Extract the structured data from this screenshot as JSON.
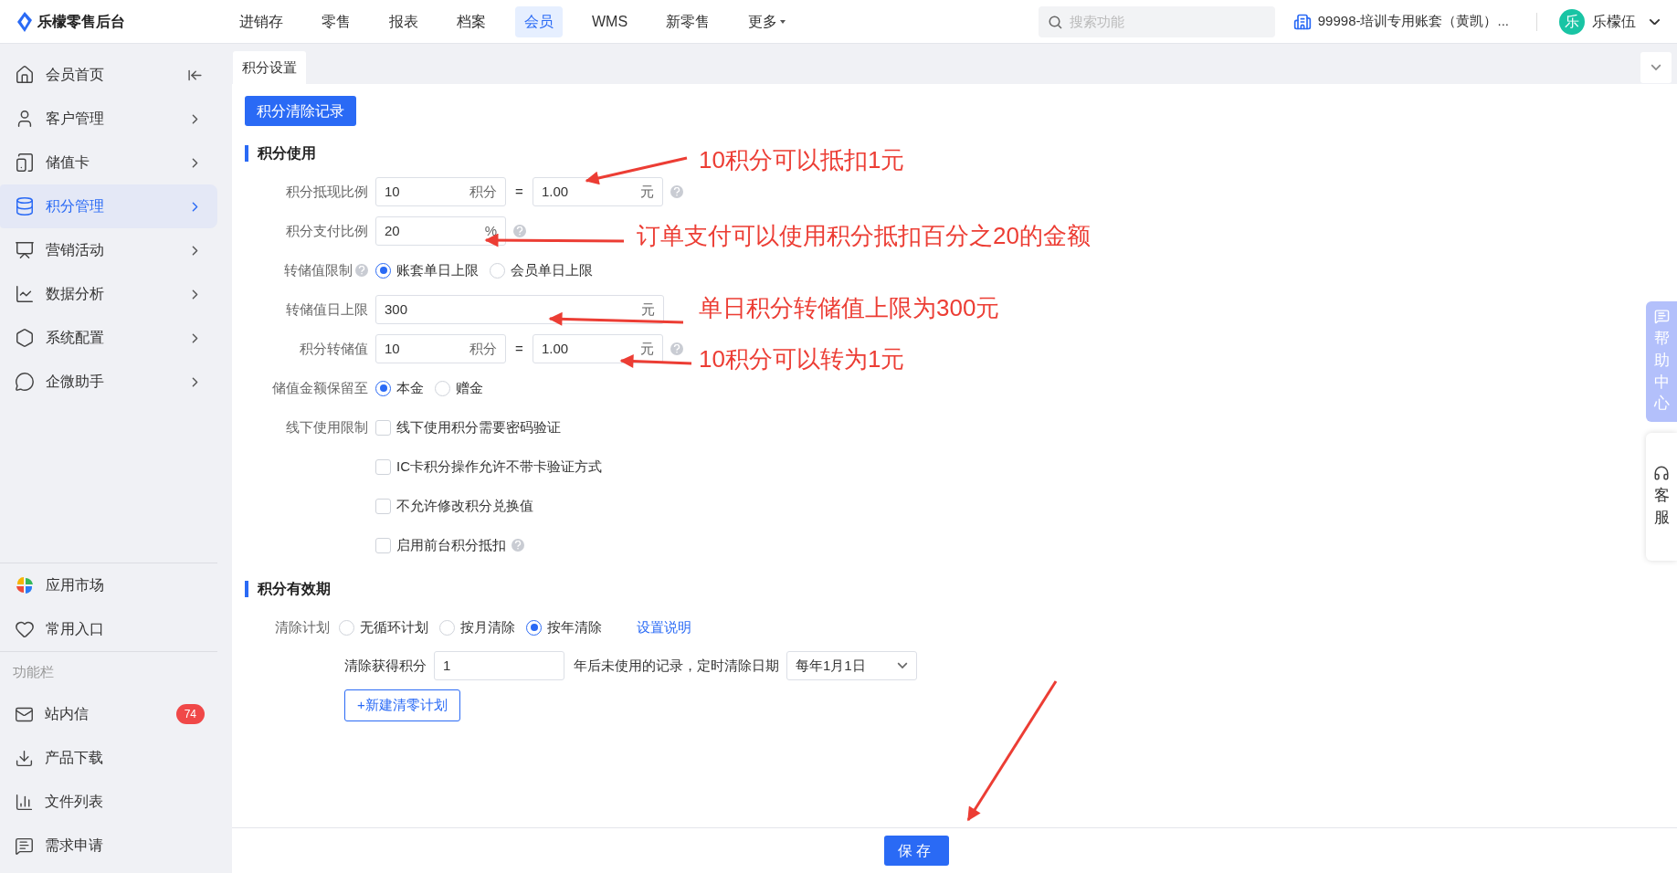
{
  "header": {
    "logo": "乐檬零售后台",
    "nav": [
      {
        "label": "进销存",
        "selected": false,
        "kind": "link"
      },
      {
        "label": "零售",
        "selected": false,
        "kind": "link"
      },
      {
        "label": "报表",
        "selected": false,
        "kind": "link"
      },
      {
        "label": "档案",
        "selected": false,
        "kind": "link"
      },
      {
        "label": "会员",
        "selected": true,
        "kind": "link"
      },
      {
        "label": "WMS",
        "selected": false,
        "kind": "link"
      },
      {
        "label": "新零售",
        "selected": false,
        "kind": "link"
      },
      {
        "label": "更多",
        "selected": false,
        "kind": "dropdown"
      }
    ],
    "search": {
      "placeholder": "搜索功能"
    },
    "account": "99998-培训专用账套（黄凯）...",
    "user": {
      "avatar": "乐",
      "name": "乐檬伍"
    }
  },
  "sidebar": {
    "items": [
      {
        "label": "会员首页",
        "selected": false,
        "kind": "collapse"
      },
      {
        "label": "客户管理",
        "selected": false,
        "kind": "submenu"
      },
      {
        "label": "储值卡",
        "selected": false,
        "kind": "submenu"
      },
      {
        "label": "积分管理",
        "selected": true,
        "kind": "submenu"
      },
      {
        "label": "营销活动",
        "selected": false,
        "kind": "submenu"
      },
      {
        "label": "数据分析",
        "selected": false,
        "kind": "submenu"
      },
      {
        "label": "系统配置",
        "selected": false,
        "kind": "submenu"
      },
      {
        "label": "企微助手",
        "selected": false,
        "kind": "submenu"
      }
    ],
    "apps": [
      {
        "label": "应用市场"
      },
      {
        "label": "常用入口"
      }
    ],
    "section_title": "功能栏",
    "tools": [
      {
        "label": "站内信",
        "badge": "74"
      },
      {
        "label": "产品下载"
      },
      {
        "label": "文件列表"
      },
      {
        "label": "需求申请"
      }
    ]
  },
  "tabs": [
    {
      "label": "积分设置",
      "selected": true
    }
  ],
  "clear_record_button": "积分清除记录",
  "usage": {
    "title": "积分使用",
    "rows": [
      {
        "kind": "ratio",
        "label": "积分抵现比例",
        "value": "10",
        "unit": "积分",
        "equals": "=",
        "value2": "1.00",
        "unit2": "元",
        "help": true
      },
      {
        "kind": "input",
        "label": "积分支付比例",
        "value": "20",
        "unit": "%",
        "wide": false,
        "help": true
      },
      {
        "kind": "radio",
        "label": "转储值限制",
        "label_help": true,
        "options": [
          {
            "label": "账套单日上限",
            "selected": true
          },
          {
            "label": "会员单日上限",
            "selected": false
          }
        ]
      },
      {
        "kind": "input",
        "label": "转储值日上限",
        "value": "300",
        "unit": "元",
        "wide": true,
        "help": false
      },
      {
        "kind": "ratio",
        "label": "积分转储值",
        "value": "10",
        "unit": "积分",
        "equals": "=",
        "value2": "1.00",
        "unit2": "元",
        "help": true
      },
      {
        "kind": "radio",
        "label": "储值金额保留至",
        "label_help": false,
        "options": [
          {
            "label": "本金",
            "selected": true
          },
          {
            "label": "赠金",
            "selected": false
          }
        ]
      },
      {
        "kind": "checkbox",
        "label": "线下使用限制",
        "options": [
          {
            "label": "线下使用积分需要密码验证",
            "checked": false,
            "help": false
          },
          {
            "label": "IC卡积分操作允许不带卡验证方式",
            "checked": false,
            "help": false
          },
          {
            "label": "不允许修改积分兑换值",
            "checked": false,
            "help": false
          },
          {
            "label": "启用前台积分抵扣",
            "checked": false,
            "help": true
          }
        ]
      }
    ]
  },
  "expiry": {
    "title": "积分有效期",
    "plan_label": "清除计划",
    "plans": [
      {
        "label": "无循环计划",
        "selected": false
      },
      {
        "label": "按月清除",
        "selected": false
      },
      {
        "label": "按年清除",
        "selected": true
      }
    ],
    "link": "设置说明",
    "rule": {
      "prefix": "清除获得积分",
      "value": "1",
      "middle": "年后未使用的记录，定时清除日期",
      "select": "每年1月1日"
    },
    "add_button": "+新建清零计划"
  },
  "save_button": "保存",
  "help_center": "帮助中心",
  "service": "客服",
  "annotations": [
    {
      "text": "10积分可以抵扣1元"
    },
    {
      "text": "订单支付可以使用积分抵扣百分之20的金额"
    },
    {
      "text": "单日积分转储值上限为300元"
    },
    {
      "text": "10积分可以转为1元"
    }
  ]
}
